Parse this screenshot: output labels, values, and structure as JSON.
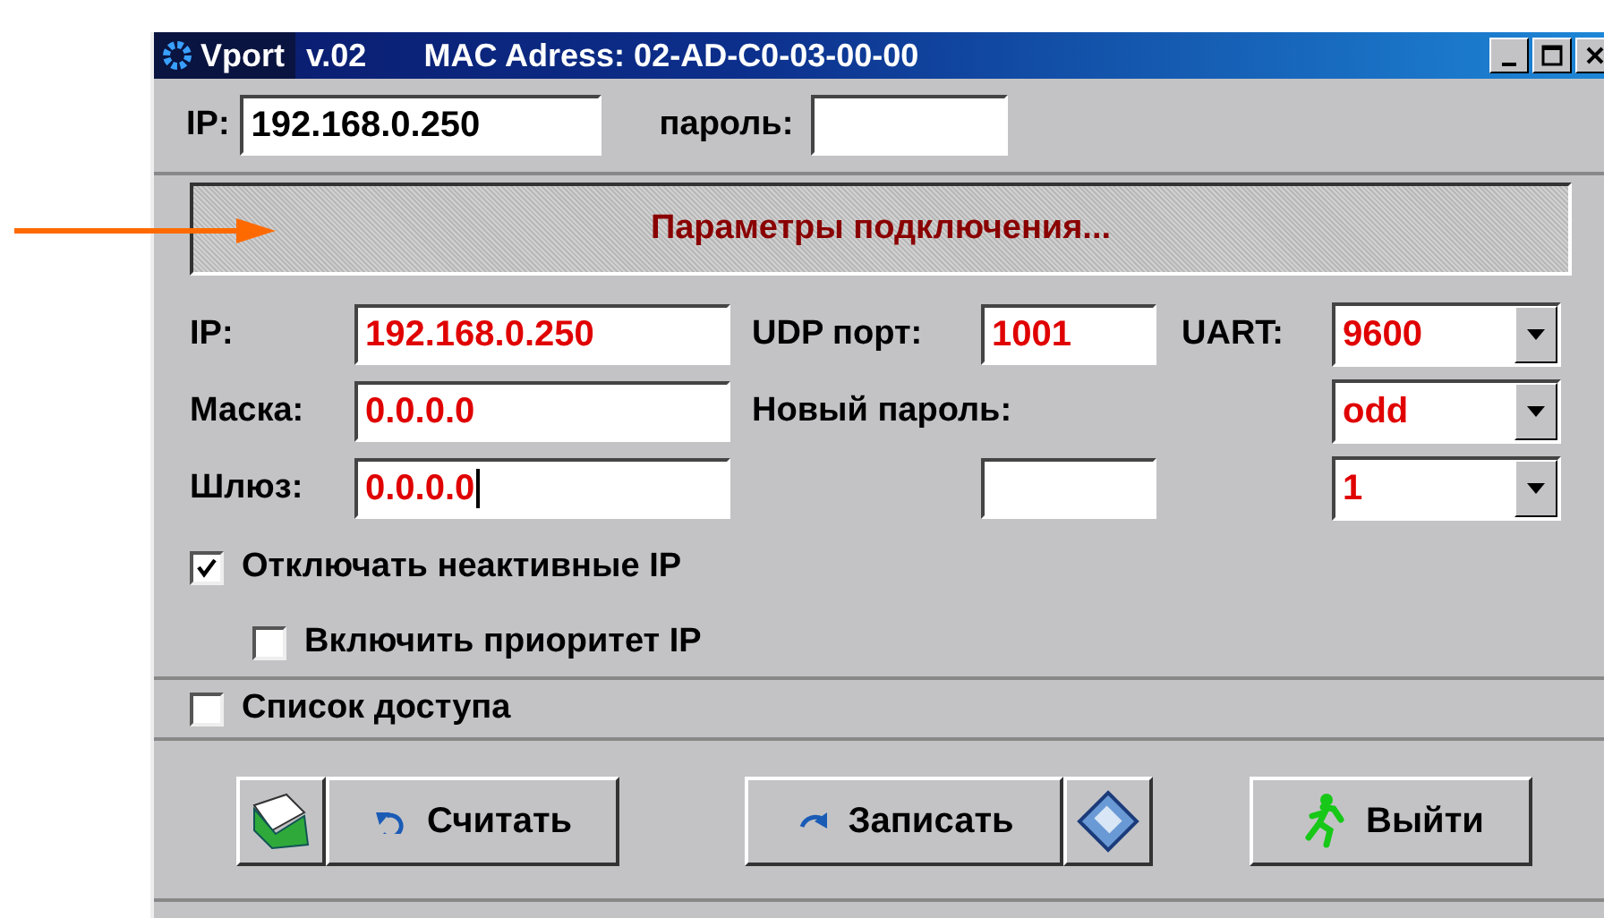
{
  "window": {
    "app": "Vport",
    "version": "v.02",
    "mac": "MAC Adress: 02-AD-C0-03-00-00"
  },
  "connection": {
    "ip_label": "IP:",
    "ip": "192.168.0.250",
    "password_label": "пароль:"
  },
  "banner": "Параметры подключения...",
  "network": [
    {
      "label": "IP:",
      "value": "192.168.0.250",
      "focused": false
    },
    {
      "label": "Маска:",
      "value": "0.0.0.0",
      "focused": false
    },
    {
      "label": "Шлюз:",
      "value": "0.0.0.0",
      "focused": true
    }
  ],
  "udp": {
    "label": "UDP порт:",
    "value": "1001"
  },
  "new_password": {
    "label": "Новый пароль:"
  },
  "uart": {
    "label": "UART:",
    "options": [
      "9600",
      "odd",
      "1"
    ]
  },
  "checks": [
    {
      "label": "Отключать неактивные IP",
      "checked": true,
      "children": [
        {
          "label": "Включить приоритет IP",
          "checked": false
        }
      ]
    }
  ],
  "access_list": {
    "label": "Список доступа",
    "checked": false
  },
  "buttons": [
    {
      "label": "Считать"
    },
    {
      "label": "Записать"
    },
    {
      "label": "Выйти"
    }
  ]
}
